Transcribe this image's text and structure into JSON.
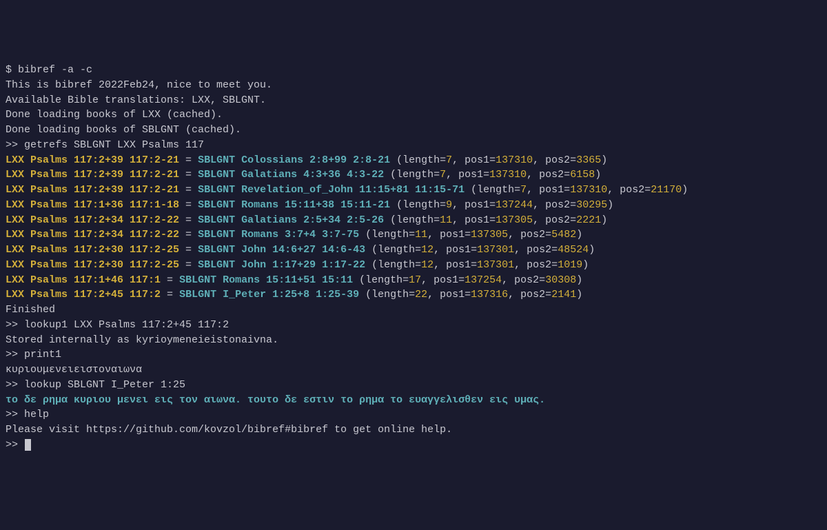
{
  "shell_prompt": "$ ",
  "shell_cmd": "bibref -a -c",
  "intro": [
    "This is bibref 2022Feb24, nice to meet you.",
    "Available Bible translations: LXX, SBLGNT.",
    "Done loading books of LXX (cached).",
    "Done loading books of SBLGNT (cached)."
  ],
  "repl_prompt": ">> ",
  "cmd_getrefs": "getrefs SBLGNT LXX Psalms 117",
  "refs": [
    {
      "lxx": "LXX Psalms 117:2+39 117:2-21",
      "eq": " = ",
      "sbl": "SBLGNT Colossians 2:8+99 2:8-21",
      "len": "7",
      "p1": "137310",
      "p2": "3365"
    },
    {
      "lxx": "LXX Psalms 117:2+39 117:2-21",
      "eq": " = ",
      "sbl": "SBLGNT Galatians 4:3+36 4:3-22",
      "len": "7",
      "p1": "137310",
      "p2": "6158"
    },
    {
      "lxx": "LXX Psalms 117:2+39 117:2-21",
      "eq": " = ",
      "sbl": "SBLGNT Revelation_of_John 11:15+81 11:15-71",
      "len": "7",
      "p1": "137310",
      "p2": "21170"
    },
    {
      "lxx": "LXX Psalms 117:1+36 117:1-18",
      "eq": " = ",
      "sbl": "SBLGNT Romans 15:11+38 15:11-21",
      "len": "9",
      "p1": "137244",
      "p2": "30295"
    },
    {
      "lxx": "LXX Psalms 117:2+34 117:2-22",
      "eq": " = ",
      "sbl": "SBLGNT Galatians 2:5+34 2:5-26",
      "len": "11",
      "p1": "137305",
      "p2": "2221"
    },
    {
      "lxx": "LXX Psalms 117:2+34 117:2-22",
      "eq": " = ",
      "sbl": "SBLGNT Romans 3:7+4 3:7-75",
      "len": "11",
      "p1": "137305",
      "p2": "5482"
    },
    {
      "lxx": "LXX Psalms 117:2+30 117:2-25",
      "eq": " = ",
      "sbl": "SBLGNT John 14:6+27 14:6-43",
      "len": "12",
      "p1": "137301",
      "p2": "48524"
    },
    {
      "lxx": "LXX Psalms 117:2+30 117:2-25",
      "eq": " = ",
      "sbl": "SBLGNT John 1:17+29 1:17-22",
      "len": "12",
      "p1": "137301",
      "p2": "1019"
    },
    {
      "lxx": "LXX Psalms 117:1+46 117:1",
      "eq": " = ",
      "sbl": "SBLGNT Romans 15:11+51 15:11",
      "len": "17",
      "p1": "137254",
      "p2": "30308"
    },
    {
      "lxx": "LXX Psalms 117:2+45 117:2",
      "eq": " = ",
      "sbl": "SBLGNT I_Peter 1:25+8 1:25-39",
      "len": "22",
      "p1": "137316",
      "p2": "2141"
    }
  ],
  "finished": "Finished",
  "cmd_lookup1": "lookup1 LXX Psalms 117:2+45 117:2",
  "stored": "Stored internally as kyrioymeneieistonaivna.",
  "cmd_print1": "print1",
  "greek1": "κυριουμενειειστοναιωνα",
  "cmd_lookup": "lookup SBLGNT I_Peter 1:25",
  "greek2": "το δε ρημα κυριου μενει εις τον αιωνα. τουτο δε εστιν το ρημα το ευαγγελισθεν εις υμας.",
  "cmd_help": "help",
  "help_text": "Please visit https://github.com/kovzol/bibref#bibref to get online help.",
  "paren_open": " (length=",
  "paren_mid1": ", pos1=",
  "paren_mid2": ", pos2=",
  "paren_close": ")"
}
